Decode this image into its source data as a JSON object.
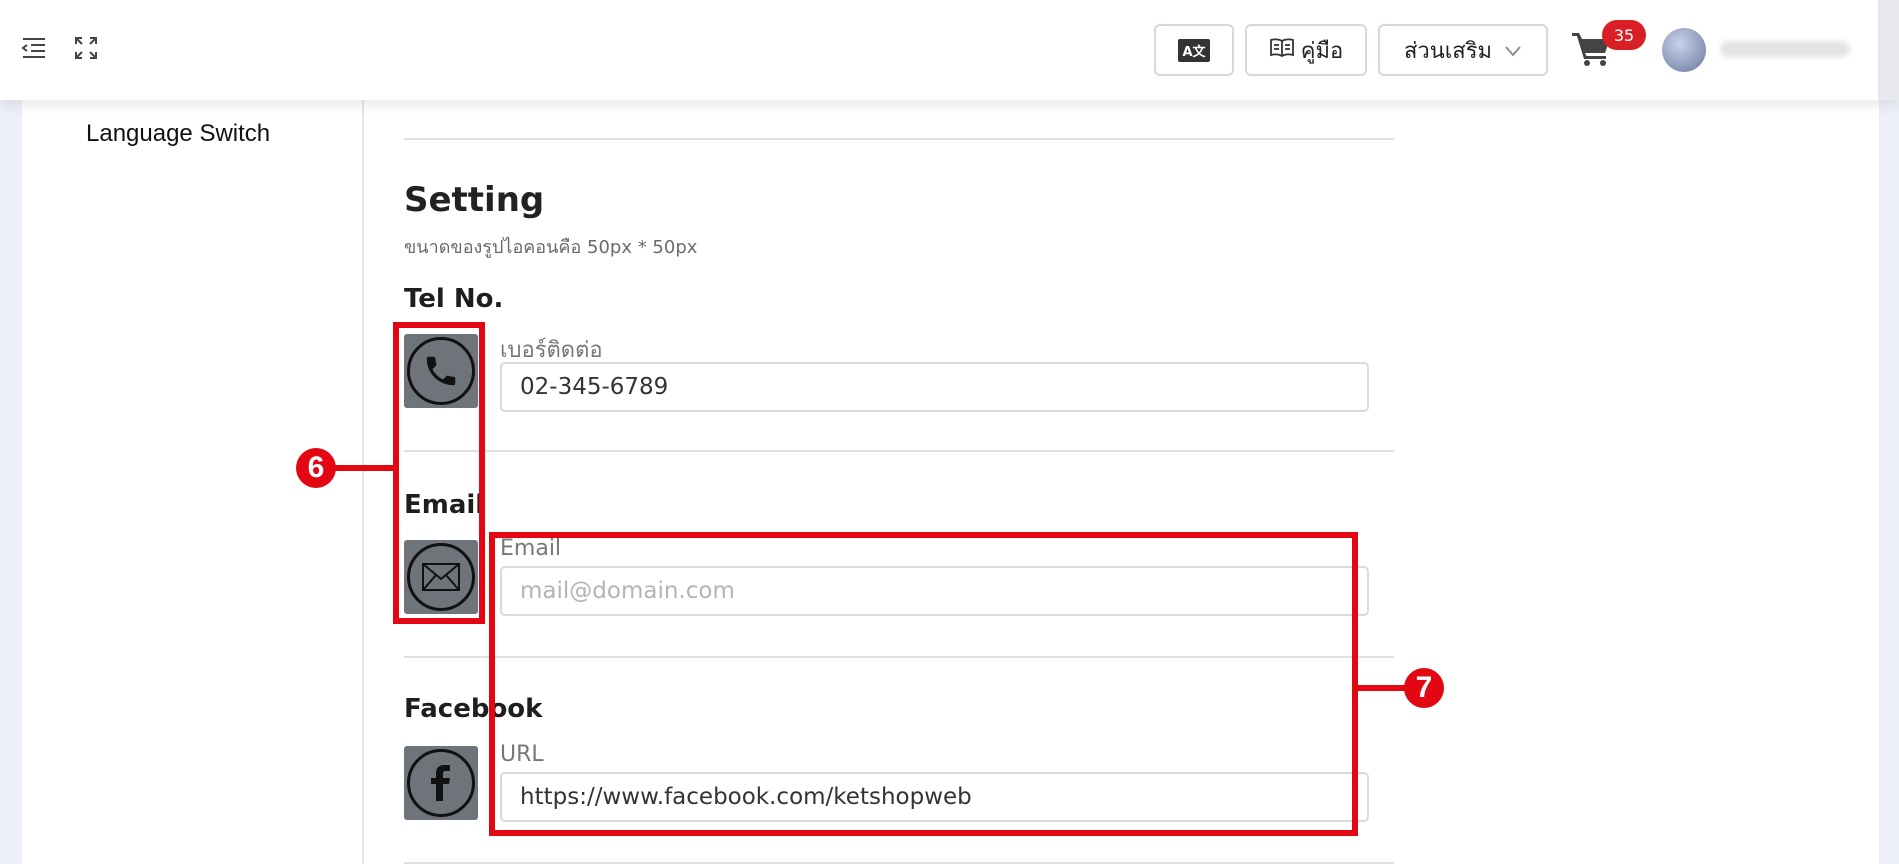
{
  "topbar": {
    "translate_label": "A文",
    "manual_label": "คู่มือ",
    "addons_label": "ส่วนเสริม",
    "cart_count": "35",
    "colors": {
      "badge": "#d81f26"
    }
  },
  "sidebar": {
    "language_switch": "Language Switch"
  },
  "setting": {
    "title": "Setting",
    "subtitle": "ขนาดของรูปไอคอนคือ 50px * 50px",
    "tel": {
      "title": "Tel No.",
      "label": "เบอร์ติดต่อ",
      "value": "02-345-6789",
      "icon": "phone-icon"
    },
    "email": {
      "title": "Email",
      "label": "Email",
      "value": "",
      "placeholder": "mail@domain.com",
      "icon": "mail-icon"
    },
    "facebook": {
      "title": "Facebook",
      "label": "URL",
      "value": "https://www.facebook.com/ketshopweb",
      "icon": "facebook-icon"
    }
  },
  "annotations": {
    "six": "6",
    "seven": "7",
    "color": "#e30613"
  }
}
